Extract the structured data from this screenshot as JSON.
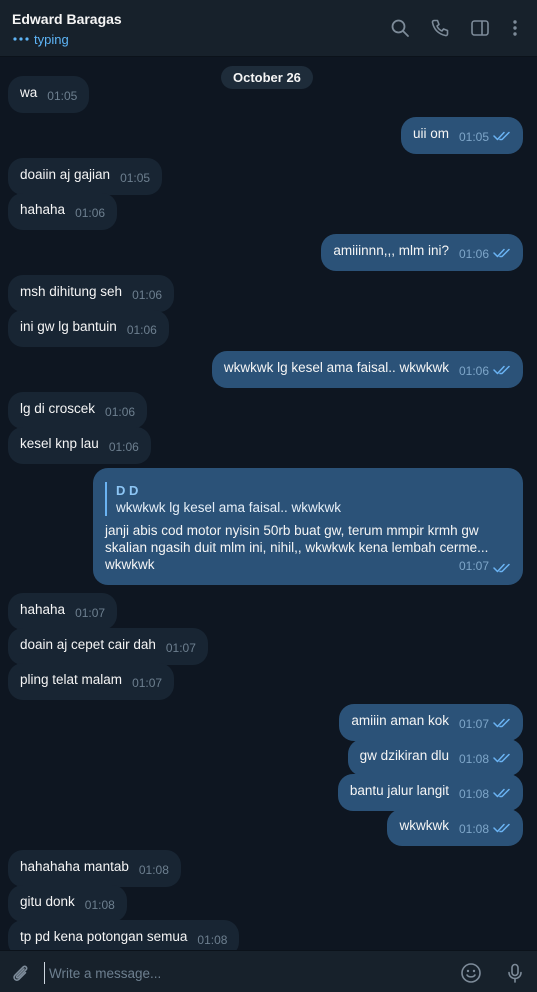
{
  "header": {
    "contact_name": "Edward Baragas",
    "status": "typing"
  },
  "chat": {
    "date": "October 26",
    "messages": [
      {
        "dir": "in",
        "text": "wa",
        "time": "01:05"
      },
      {
        "dir": "out",
        "text": "uii om",
        "time": "01:05"
      },
      {
        "dir": "in",
        "text": "doaiin aj gajian",
        "time": "01:05"
      },
      {
        "dir": "in",
        "text": "hahaha",
        "time": "01:06"
      },
      {
        "dir": "out",
        "text": "amiiinnn,,, mlm ini?",
        "time": "01:06"
      },
      {
        "dir": "in",
        "text": "msh dihitung seh",
        "time": "01:06"
      },
      {
        "dir": "in",
        "text": "ini gw lg bantuin",
        "time": "01:06"
      },
      {
        "dir": "out",
        "text": "wkwkwk lg kesel ama faisal.. wkwkwk",
        "time": "01:06"
      },
      {
        "dir": "in",
        "text": "lg di croscek",
        "time": "01:06"
      },
      {
        "dir": "in",
        "text": "kesel knp lau",
        "time": "01:06"
      },
      {
        "dir": "out",
        "quote_name": "D D",
        "quote_text": "wkwkwk lg kesel ama faisal.. wkwkwk",
        "text": "janji abis cod motor nyisin 50rb buat gw, terum mmpir krmh gw skalian ngasih duit mlm ini, nihil,, wkwkwk kena lembah cerme... wkwkwk",
        "time": "01:07"
      },
      {
        "dir": "in",
        "text": "hahaha",
        "time": "01:07"
      },
      {
        "dir": "in",
        "text": "doain aj cepet cair dah",
        "time": "01:07"
      },
      {
        "dir": "in",
        "text": "pling telat malam",
        "time": "01:07"
      },
      {
        "dir": "out",
        "text": "amiiin aman kok",
        "time": "01:07"
      },
      {
        "dir": "out",
        "text": "gw dzikiran dlu",
        "time": "01:08"
      },
      {
        "dir": "out",
        "text": "bantu jalur langit",
        "time": "01:08"
      },
      {
        "dir": "out",
        "text": "wkwkwk",
        "time": "01:08"
      },
      {
        "dir": "in",
        "text": "hahahaha mantab",
        "time": "01:08"
      },
      {
        "dir": "in",
        "text": "gitu donk",
        "time": "01:08"
      },
      {
        "dir": "in",
        "text": "tp pd kena potongan semua",
        "time": "01:08"
      }
    ]
  },
  "composer": {
    "placeholder": "Write a message..."
  },
  "icons": {
    "search": "search-icon",
    "call": "phone-icon",
    "sidebar": "sidebar-toggle-icon",
    "more": "more-vertical-icon",
    "attach": "paperclip-icon",
    "emoji": "emoji-icon",
    "mic": "microphone-icon"
  },
  "colors": {
    "accent": "#5eb5f7",
    "incoming_bubble": "#182533",
    "outgoing_bubble": "#2b5278",
    "background": "#0e1621",
    "header": "#17212b"
  }
}
